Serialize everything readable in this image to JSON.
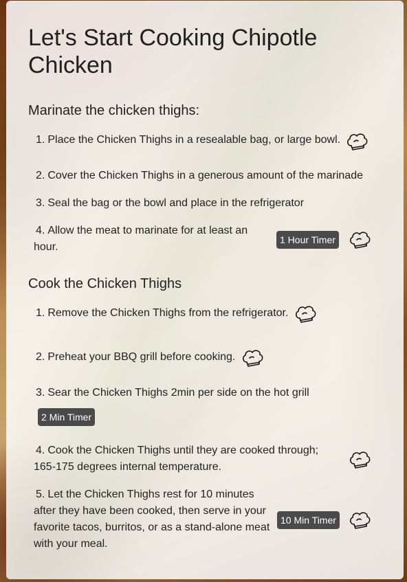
{
  "page": {
    "title": "Let's Start Cooking Chipotle Chicken"
  },
  "sections": [
    {
      "heading": "Marinate the chicken thighs:",
      "steps": [
        {
          "num": "1.",
          "text": "Place the Chicken Thighs in a resealable bag, or large bowl."
        },
        {
          "num": "2.",
          "text": "Cover the Chicken Thighs in a generous amount of the marinade"
        },
        {
          "num": "3.",
          "text": "Seal the bag or the bowl and place in the refrigerator"
        },
        {
          "num": "4.",
          "text": "Allow the meat to marinate for at least an hour.",
          "timer": "1 Hour Timer"
        }
      ]
    },
    {
      "heading": "Cook the Chicken Thighs",
      "steps": [
        {
          "num": "1.",
          "text": "Remove the Chicken Thighs from the refrigerator."
        },
        {
          "num": "2.",
          "text": "Preheat your BBQ grill before cooking."
        },
        {
          "num": "3.",
          "text": "Sear the Chicken Thighs 2min per side on the hot grill",
          "timer": "2 Min Timer"
        },
        {
          "num": "4.",
          "text": "Cook the Chicken Thighs until they are cooked through; 165-175 degrees internal temperature."
        },
        {
          "num": "5.",
          "text": "Let the Chicken Thighs rest for 10 minutes after they have been cooked, then serve in your favorite tacos, burritos, or as a stand-alone meat with your meal.",
          "timer": "10 Min Timer"
        }
      ]
    }
  ],
  "icons": {
    "step_action": "chef-hat-icon"
  }
}
